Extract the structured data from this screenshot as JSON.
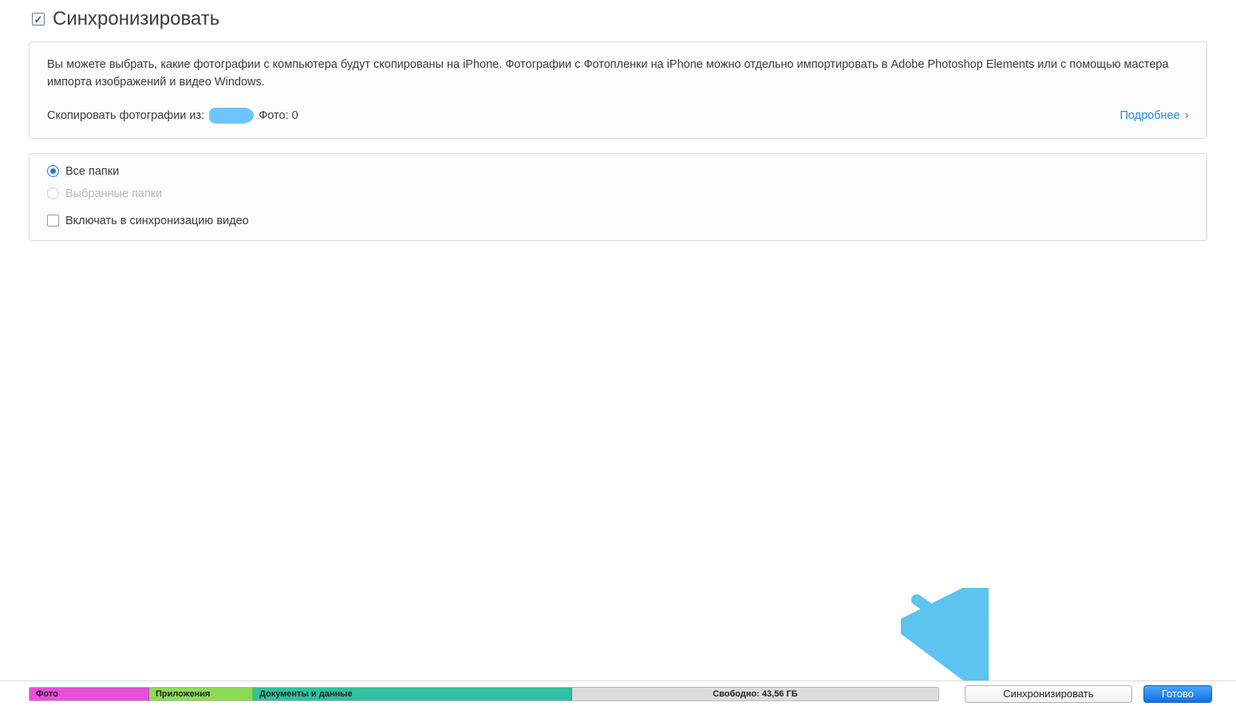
{
  "header": {
    "title": "Синхронизировать",
    "checked": true
  },
  "info_panel": {
    "description": "Вы можете выбрать, какие фотографии с компьютера будут скопированы на iPhone. Фотографии с Фотопленки на iPhone можно отдельно импортировать в Adobe Photoshop Elements или с помощью мастера импорта изображений и видео Windows.",
    "copy_label": "Скопировать фотографии из:",
    "photo_count_label": "Фото: 0",
    "learn_more": "Подробнее"
  },
  "options": {
    "all_folders": "Все папки",
    "selected_folders": "Выбранные папки",
    "include_video": "Включать в синхронизацию видео"
  },
  "storage": {
    "photo": "Фото",
    "apps": "Приложения",
    "docs": "Документы и данные",
    "free": "Свободно: 43,56 ГБ"
  },
  "footer": {
    "sync_button": "Синхронизировать",
    "done_button": "Готово"
  }
}
